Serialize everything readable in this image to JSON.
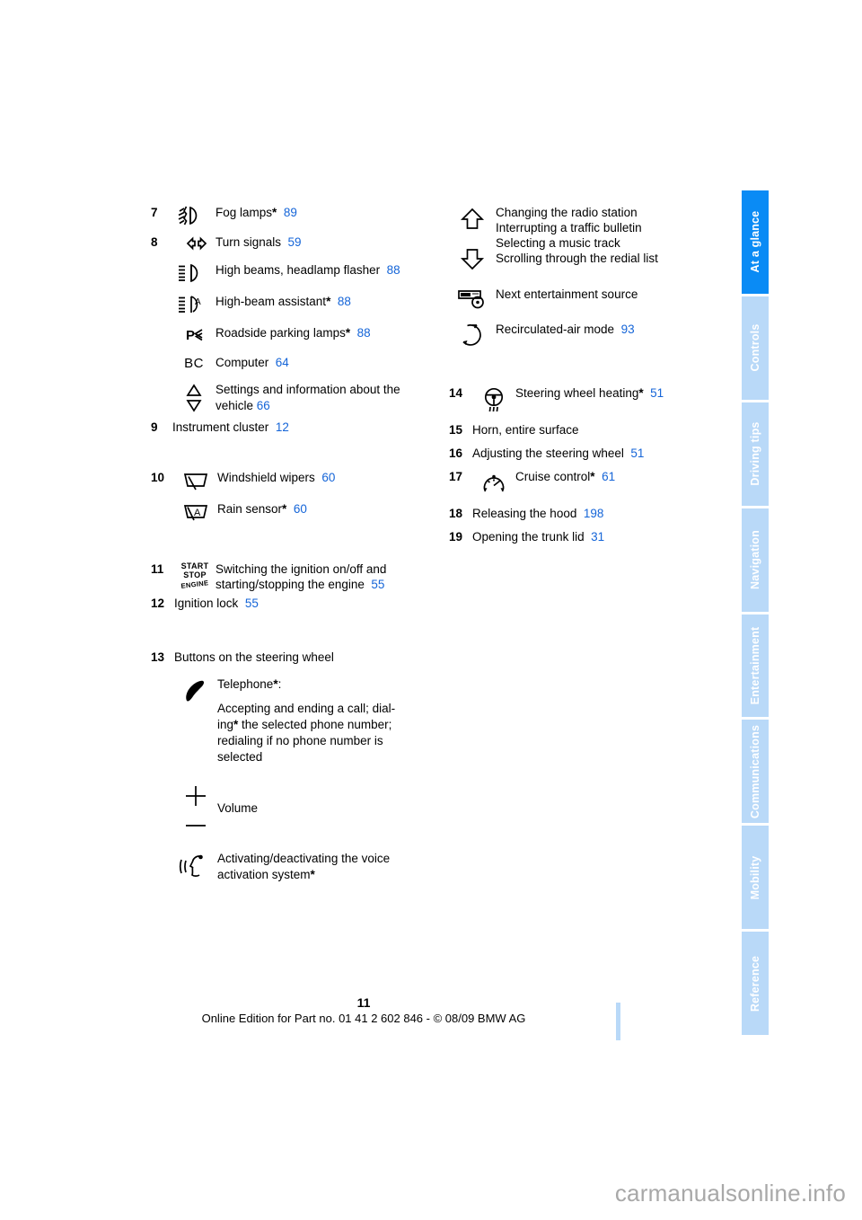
{
  "document": {
    "page_number": "11",
    "edition_line": "Online Edition for Part no. 01 41 2 602 846 - © 08/09 BMW AG",
    "watermark": "carmanualsonline.info",
    "accent_blue": "#1565d8",
    "tab_active_color": "#0a8bf5",
    "tab_inactive_color": "#b9d9f8"
  },
  "tabs": [
    {
      "label": "At a glance",
      "active": true
    },
    {
      "label": "Controls",
      "active": false
    },
    {
      "label": "Driving tips",
      "active": false
    },
    {
      "label": "Navigation",
      "active": false
    },
    {
      "label": "Entertainment",
      "active": false
    },
    {
      "label": "Communications",
      "active": false
    },
    {
      "label": "Mobility",
      "active": false
    },
    {
      "label": "Reference",
      "active": false
    }
  ],
  "left_column": {
    "item7": {
      "number": "7",
      "label": "Fog lamps",
      "star": "*",
      "page": "89",
      "icon": "fog-lamp-icon"
    },
    "item8": {
      "number": "8",
      "sub": [
        {
          "label": "Turn signals",
          "star": "",
          "page": "59",
          "icon": "turn-signal-icon"
        },
        {
          "label": "High beams, headlamp flasher",
          "star": "",
          "page": "88",
          "icon": "high-beam-icon"
        },
        {
          "label": "High-beam assistant",
          "star": "*",
          "page": "88",
          "icon": "high-beam-assistant-icon"
        },
        {
          "label": "Roadside parking lamps",
          "star": "*",
          "page": "88",
          "icon": "roadside-parking-lamp-icon"
        },
        {
          "label": "Computer",
          "star": "",
          "page": "64",
          "icon": "board-computer-icon"
        },
        {
          "label": "Settings and information about the vehicle",
          "star": "",
          "page": "66",
          "icon": "up-down-triangle-icon"
        }
      ]
    },
    "item9": {
      "number": "9",
      "label": "Instrument cluster",
      "page": "12"
    },
    "item10": {
      "number": "10",
      "sub": [
        {
          "label": "Windshield wipers",
          "star": "",
          "page": "60",
          "icon": "windshield-wiper-icon"
        },
        {
          "label": "Rain sensor",
          "star": "*",
          "page": "60",
          "icon": "rain-sensor-icon"
        }
      ]
    },
    "item11": {
      "number": "11",
      "label": "Switching the ignition on/off and starting/stopping the engine",
      "page": "55",
      "icon": "start-stop-engine-icon",
      "icon_text": {
        "line1": "START",
        "line2": "STOP",
        "line3": "ENGINE"
      }
    },
    "item12": {
      "number": "12",
      "label": "Ignition lock",
      "page": "55"
    },
    "item13": {
      "number": "13",
      "label": "Buttons on the steering wheel",
      "sub": [
        {
          "icon": "telephone-handset-icon",
          "title": "Telephone",
          "star": "*",
          "colon": ":",
          "body_1": "Accepting and ending a call; dial-",
          "body_2a": "ing",
          "body_2b": " the selected phone number;",
          "body_3": "redialing if no phone number is",
          "body_4": "selected"
        },
        {
          "icon": "plus-minus-volume-icon",
          "label": "Volume"
        },
        {
          "icon": "voice-activation-icon",
          "label_1": "Activating/deactivating the voice",
          "label_2": "activation system",
          "star": "*"
        }
      ]
    }
  },
  "right_column": {
    "arrows_block": {
      "icon_up": "arrow-up-icon",
      "icon_down": "arrow-down-icon",
      "lines": [
        "Changing the radio station",
        "Interrupting a traffic bulletin",
        "Selecting a music track",
        "Scrolling through the redial list"
      ]
    },
    "entertainment_source": {
      "label": "Next entertainment source",
      "icon": "entertainment-source-icon"
    },
    "recirculated_air": {
      "label": "Recirculated-air mode",
      "page": "93",
      "icon": "recirculated-air-icon"
    },
    "item14": {
      "number": "14",
      "label": "Steering wheel heating",
      "star": "*",
      "page": "51",
      "icon": "steering-wheel-heating-icon"
    },
    "item15": {
      "number": "15",
      "label": "Horn, entire surface"
    },
    "item16": {
      "number": "16",
      "label": "Adjusting the steering wheel",
      "page": "51"
    },
    "item17": {
      "number": "17",
      "label": "Cruise control",
      "star": "*",
      "page": "61",
      "icon": "cruise-control-icon"
    },
    "item18": {
      "number": "18",
      "label": "Releasing the hood",
      "page": "198"
    },
    "item19": {
      "number": "19",
      "label": "Opening the trunk lid",
      "page": "31"
    }
  }
}
